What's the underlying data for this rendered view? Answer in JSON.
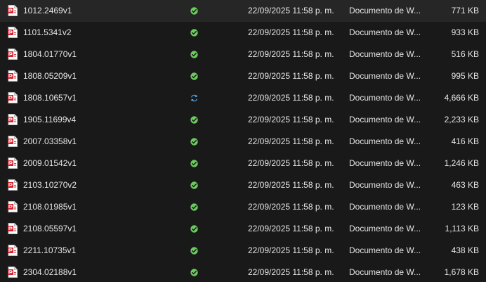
{
  "icons": {
    "file": "pdf-file-icon",
    "status_synced": "synced-check-icon",
    "status_syncing": "syncing-arrows-icon"
  },
  "colors": {
    "background": "#191919",
    "text": "#e6e6e6",
    "pdf_red": "#d3232f",
    "synced_green": "#6ccb5f",
    "syncing_blue": "#4fa3e8"
  },
  "files": [
    {
      "name": "1012.2469v1",
      "status": "synced",
      "modified": "22/09/2025 11:58 p. m.",
      "type": "Documento de W...",
      "size": "771 KB"
    },
    {
      "name": "1101.5341v2",
      "status": "synced",
      "modified": "22/09/2025 11:58 p. m.",
      "type": "Documento de W...",
      "size": "933 KB"
    },
    {
      "name": "1804.01770v1",
      "status": "synced",
      "modified": "22/09/2025 11:58 p. m.",
      "type": "Documento de W...",
      "size": "516 KB"
    },
    {
      "name": "1808.05209v1",
      "status": "synced",
      "modified": "22/09/2025 11:58 p. m.",
      "type": "Documento de W...",
      "size": "995 KB"
    },
    {
      "name": "1808.10657v1",
      "status": "syncing",
      "modified": "22/09/2025 11:58 p. m.",
      "type": "Documento de W...",
      "size": "4,666 KB"
    },
    {
      "name": "1905.11699v4",
      "status": "synced",
      "modified": "22/09/2025 11:58 p. m.",
      "type": "Documento de W...",
      "size": "2,233 KB"
    },
    {
      "name": "2007.03358v1",
      "status": "synced",
      "modified": "22/09/2025 11:58 p. m.",
      "type": "Documento de W...",
      "size": "416 KB"
    },
    {
      "name": "2009.01542v1",
      "status": "synced",
      "modified": "22/09/2025 11:58 p. m.",
      "type": "Documento de W...",
      "size": "1,246 KB"
    },
    {
      "name": "2103.10270v2",
      "status": "synced",
      "modified": "22/09/2025 11:58 p. m.",
      "type": "Documento de W...",
      "size": "463 KB"
    },
    {
      "name": "2108.01985v1",
      "status": "synced",
      "modified": "22/09/2025 11:58 p. m.",
      "type": "Documento de W...",
      "size": "123 KB"
    },
    {
      "name": "2108.05597v1",
      "status": "synced",
      "modified": "22/09/2025 11:58 p. m.",
      "type": "Documento de W...",
      "size": "1,113 KB"
    },
    {
      "name": "2211.10735v1",
      "status": "synced",
      "modified": "22/09/2025 11:58 p. m.",
      "type": "Documento de W...",
      "size": "438 KB"
    },
    {
      "name": "2304.02188v1",
      "status": "synced",
      "modified": "22/09/2025 11:58 p. m.",
      "type": "Documento de W...",
      "size": "1,678 KB"
    }
  ]
}
